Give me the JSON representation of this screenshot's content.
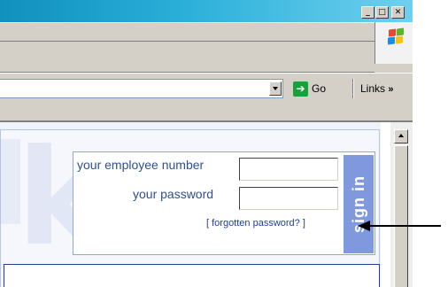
{
  "window": {
    "caption_buttons": {
      "minimize_icon": "minimize-icon",
      "maximize_icon": "maximize-icon",
      "close_icon": "close-icon"
    }
  },
  "toolbar": {
    "go_label": "Go",
    "links_label": "Links",
    "links_chevron": "»"
  },
  "login": {
    "employee_number_label": "your employee number",
    "password_label": "your password",
    "forgot_link": "[ forgotten password? ]",
    "sign_in_label": "sign in"
  },
  "colors": {
    "titlebar_accent": "#2bb0da",
    "login_text": "#2f4f8f",
    "sign_in_bg": "#7f98de",
    "go_green": "#19a03a"
  }
}
